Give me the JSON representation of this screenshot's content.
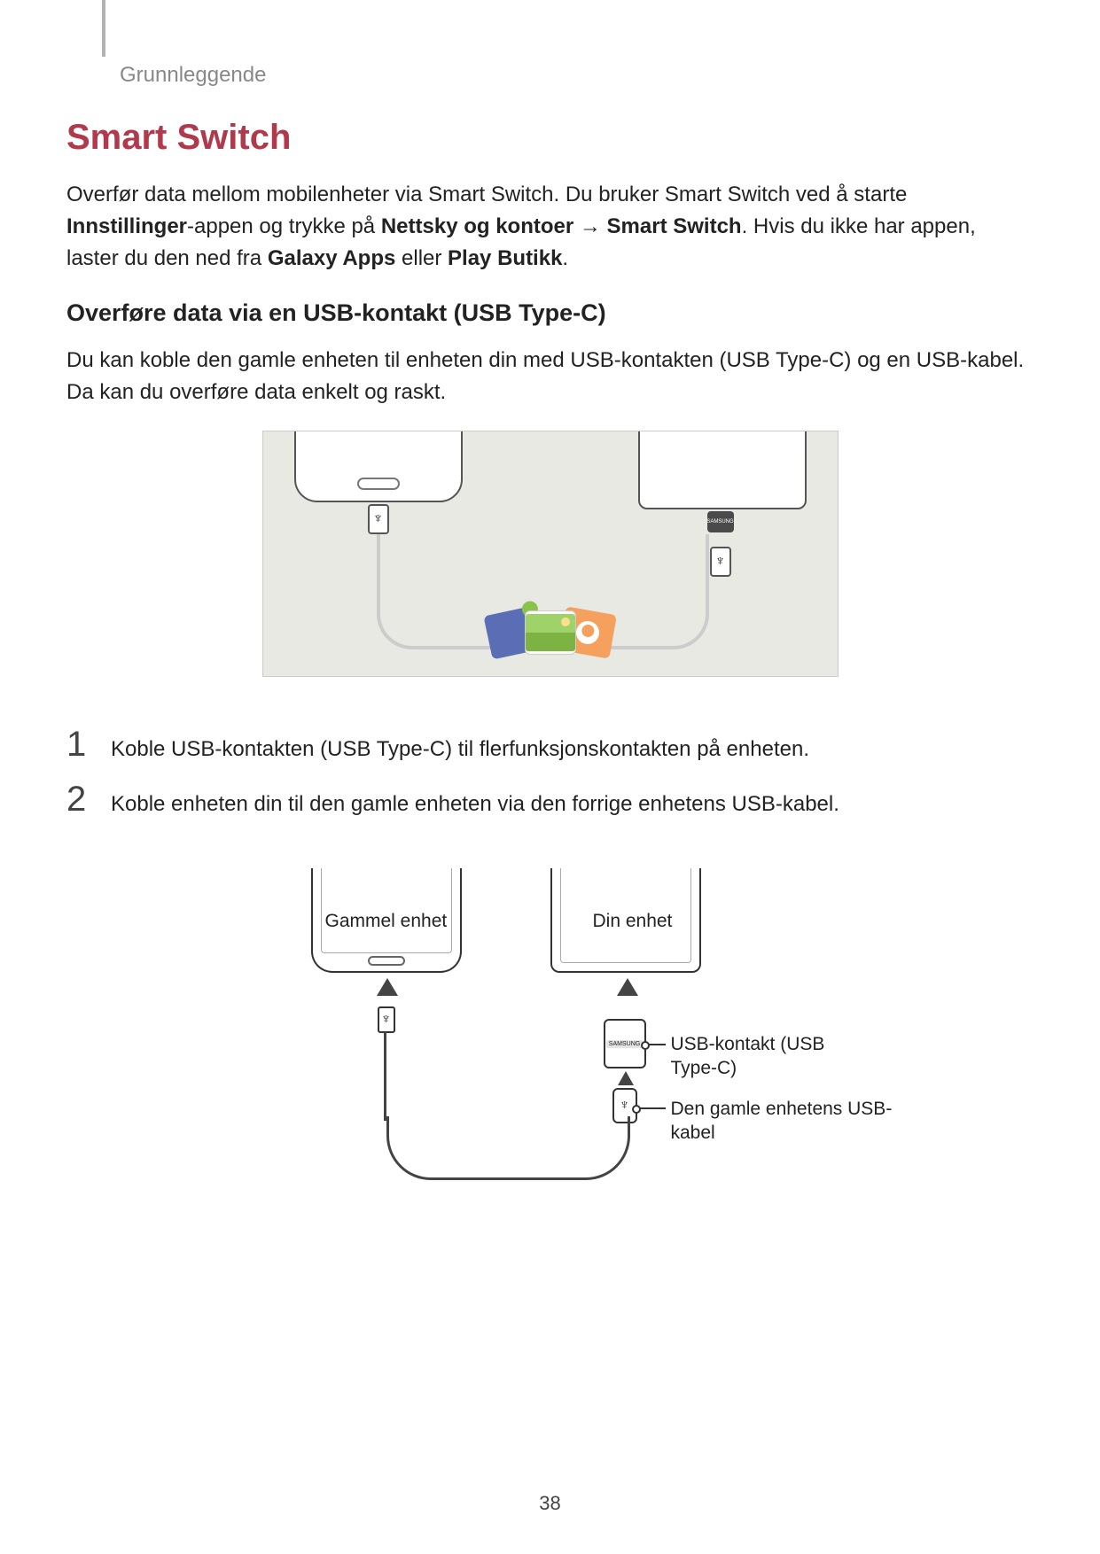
{
  "header": {
    "breadcrumb": "Grunnleggende"
  },
  "title": "Smart Switch",
  "intro": {
    "pre": "Overfør data mellom mobilenheter via Smart Switch. Du bruker Smart Switch ved å starte ",
    "b1": "Innstillinger",
    "mid1": "-appen og trykke på ",
    "b2": "Nettsky og kontoer",
    "arrow": " → ",
    "b3": "Smart Switch",
    "mid2": ". Hvis du ikke har appen, laster du den ned fra ",
    "b4": "Galaxy Apps",
    "mid3": " eller ",
    "b5": "Play Butikk",
    "end": "."
  },
  "subheading": "Overføre data via en USB-kontakt (USB Type-C)",
  "subpara": "Du kan koble den gamle enheten til enheten din med USB-kontakten (USB Type-C) og en USB-kabel. Da kan du overføre data enkelt og raskt.",
  "figure1": {
    "connector_brand": "SAMSUNG"
  },
  "steps": [
    {
      "num": "1",
      "text": "Koble USB-kontakten (USB Type-C) til flerfunksjonskontakten på enheten."
    },
    {
      "num": "2",
      "text": "Koble enheten din til den gamle enheten via den forrige enhetens USB-kabel."
    }
  ],
  "figure2": {
    "label_old": "Gammel enhet",
    "label_new": "Din enhet",
    "callout_connector": "USB-kontakt (USB Type-C)",
    "callout_cable": "Den gamle enhetens USB-kabel",
    "connector_brand": "SAMSUNG"
  },
  "page_number": "38"
}
